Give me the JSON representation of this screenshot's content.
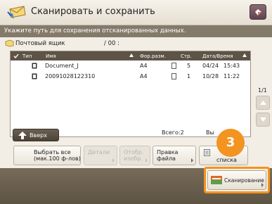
{
  "header": {
    "title": "Сканировать и сохранить"
  },
  "instruction": "Укажите путь для сохранения отсканированных данных.",
  "path": {
    "label": "Почтовый ящик",
    "value": "/ 00 :"
  },
  "list": {
    "columns": {
      "type": "Тип",
      "name": "Имя",
      "format": "Фор.разм.",
      "pages": "Стр.",
      "datetime": "Дата/Время"
    },
    "rows": [
      {
        "name": "Document_J",
        "format": "A4",
        "pages": "5",
        "date": "04/24",
        "time": "15:43"
      },
      {
        "name": "20091028122310",
        "format": "A4",
        "pages": "1",
        "date": "10/28",
        "time": "11:22"
      }
    ]
  },
  "nav": {
    "up_label": "Вверх",
    "total": "Всего:2",
    "selected": "Вы",
    "page_indicator": "1/1"
  },
  "actions": {
    "select_all": "Выбрать все\n(мак.100 ф-лов)",
    "details": "Детали",
    "show_image": "Отобр.\nизобр.",
    "edit_file": "Правка\nфайла",
    "list_label": "списка"
  },
  "badge": "3",
  "scan": {
    "label": "Сканирование"
  },
  "colors": {
    "highlight": "#f39320",
    "instruction_bar": "#847a6a",
    "bottom_bar": "#6b604f"
  }
}
